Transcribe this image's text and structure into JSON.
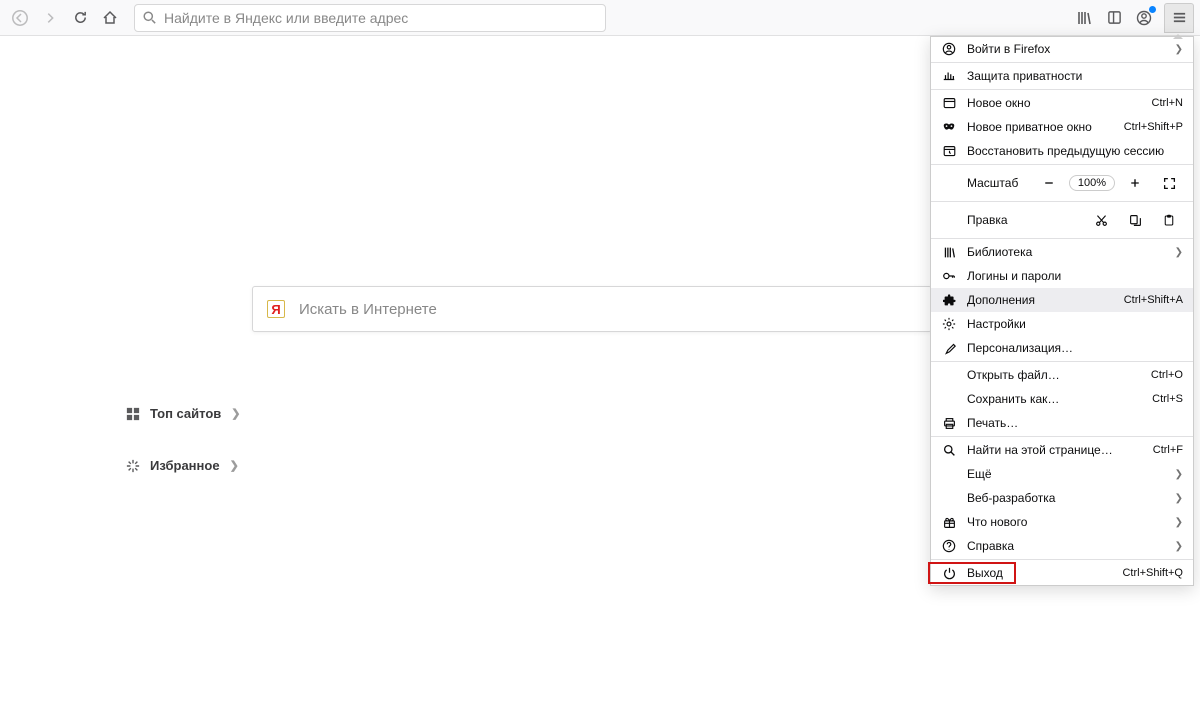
{
  "urlbar": {
    "placeholder": "Найдите в Яндекс или введите адрес"
  },
  "content": {
    "search_placeholder": "Искать в Интернете",
    "topsites_label": "Топ сайтов",
    "favorites_label": "Избранное"
  },
  "menu": {
    "signin": "Войти в Firefox",
    "privacy": "Защита приватности",
    "new_window": {
      "label": "Новое окно",
      "shortcut": "Ctrl+N"
    },
    "new_private": {
      "label": "Новое приватное окно",
      "shortcut": "Ctrl+Shift+P"
    },
    "restore": "Восстановить предыдущую сессию",
    "zoom_label": "Масштаб",
    "zoom_value": "100%",
    "edit_label": "Правка",
    "library": "Библиотека",
    "logins": "Логины и пароли",
    "addons": {
      "label": "Дополнения",
      "shortcut": "Ctrl+Shift+A"
    },
    "settings": "Настройки",
    "customize": "Персонализация…",
    "open_file": {
      "label": "Открыть файл…",
      "shortcut": "Ctrl+O"
    },
    "save_as": {
      "label": "Сохранить как…",
      "shortcut": "Ctrl+S"
    },
    "print": "Печать…",
    "find": {
      "label": "Найти на этой странице…",
      "shortcut": "Ctrl+F"
    },
    "more": "Ещё",
    "webdev": "Веб-разработка",
    "whatsnew": "Что нового",
    "help": "Справка",
    "exit": {
      "label": "Выход",
      "shortcut": "Ctrl+Shift+Q"
    }
  }
}
